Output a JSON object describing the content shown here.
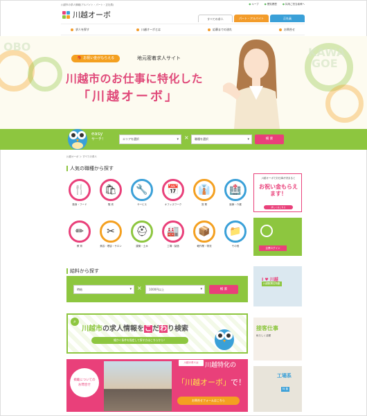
{
  "header": {
    "tagline": "川越市の求人情報(アルバイト・パート・正社員)",
    "logo_text": "川越オーボ",
    "links": [
      "キープ",
      "閲覧履歴",
      "採用ご担当者様へ"
    ],
    "tabs": [
      "すべての求人",
      "パート・アルバイト",
      "正社員"
    ]
  },
  "nav": {
    "items": [
      "求人を探す",
      "川越オーボとは",
      "応募までの流れ",
      "お問合せ"
    ]
  },
  "hero": {
    "badge": "お祝い金がもらえる",
    "subtitle": "地元密着求人サイト",
    "title_line1": "川越市のお仕事に特化した",
    "title_line2": "「川越オーボ」",
    "bg_words": [
      "OBO",
      "KAWA",
      "GOE"
    ]
  },
  "search": {
    "easy_label": "easy",
    "easy_sub": "サーチ！",
    "area_placeholder": "エリアを選択",
    "job_placeholder": "職種を選択",
    "button": "検 索"
  },
  "breadcrumb": "川越オーボ ＞ すべての求人",
  "categories": {
    "title": "人気の職種から探す",
    "items": [
      {
        "label": "飲食・フード",
        "icon": "🍴",
        "color": "#e9407a"
      },
      {
        "label": "販 売",
        "icon": "🛍",
        "color": "#e9407a"
      },
      {
        "label": "サービス",
        "icon": "🔧",
        "color": "#3aa0d8"
      },
      {
        "label": "オフィスワーク",
        "icon": "📅",
        "color": "#e9407a"
      },
      {
        "label": "営 業",
        "icon": "👔",
        "color": "#f4a020"
      },
      {
        "label": "医療・介護",
        "icon": "🏥",
        "color": "#3aa0d8"
      },
      {
        "label": "教 育",
        "icon": "✏",
        "color": "#e9407a"
      },
      {
        "label": "美容・理容・サロン",
        "icon": "✂",
        "color": "#f4a020"
      },
      {
        "label": "建築・土木",
        "icon": "⛑",
        "color": "#8dc63f"
      },
      {
        "label": "工場・製造",
        "icon": "🏭",
        "color": "#e9407a"
      },
      {
        "label": "軽作業・物流",
        "icon": "📦",
        "color": "#f4a020"
      },
      {
        "label": "その他",
        "icon": "📁",
        "color": "#3aa0d8"
      }
    ]
  },
  "salary": {
    "title": "給料から探す",
    "type_value": "時給",
    "amount_value": "1000円以上",
    "button": "検 索"
  },
  "banner_detail": {
    "title_a": "川越市",
    "title_b": "の求人情報を",
    "title_c": "こ",
    "title_d": "だ",
    "title_e": "わ",
    "title_f": "り",
    "title_g": "検索",
    "sub": "細かく条件を指定して探す方はこちらから！"
  },
  "banner_contact": {
    "circle_line1": "掲載についての",
    "circle_line2": "お問合せ",
    "tag": "川越の求人は",
    "line1": "川越特化の",
    "line2_a": "「川越オーボ」",
    "line2_b": "で！",
    "button": "お問合せフォームはこちら"
  },
  "sidebar": {
    "bonus_top": "川越オーボでお仕事が決まると",
    "bonus_main": "お祝い金もらえます！",
    "bonus_btn": "詳しくはこちら",
    "login_btn": "企業ログイン",
    "feature1_title": "I ♥ 川越",
    "feature1_sub": "川越駅周辺特集",
    "feature2_title": "接客仕事",
    "feature2_sub": "私らしく活躍",
    "feature3_title": "工場系",
    "feature3_sub": "特 集"
  }
}
